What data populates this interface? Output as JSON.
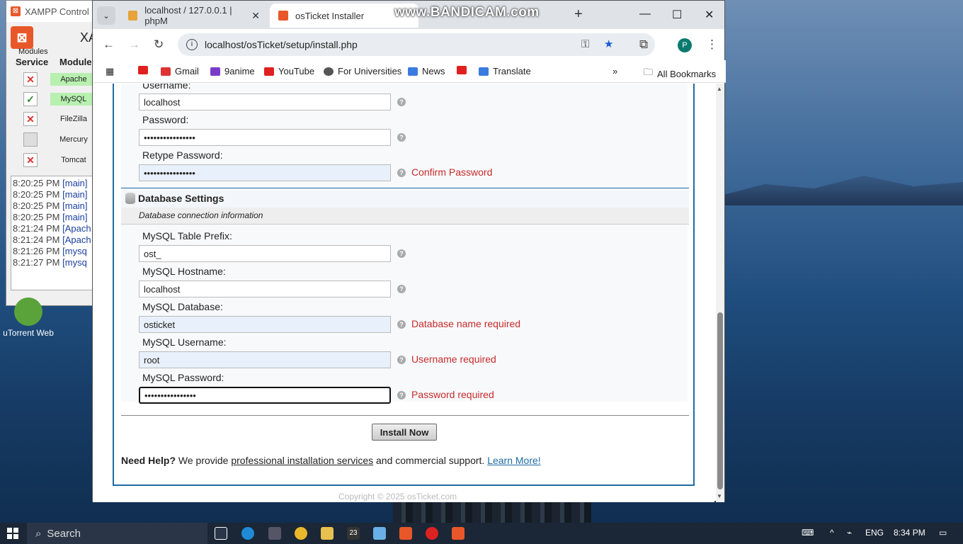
{
  "xampp": {
    "title": "XAMPP Control P",
    "header_partial": "XA",
    "modules_label": "Modules",
    "service_header": "Service",
    "module_header": "Module",
    "modules": [
      {
        "name": "Apache",
        "status": "x"
      },
      {
        "name": "MySQL",
        "status": "ok"
      },
      {
        "name": "FileZilla",
        "status": "x"
      },
      {
        "name": "Mercury",
        "status": "blank"
      },
      {
        "name": "Tomcat",
        "status": "x"
      }
    ],
    "log": [
      {
        "time": "8:20:25 PM",
        "tag": "[main]"
      },
      {
        "time": "8:20:25 PM",
        "tag": "[main]"
      },
      {
        "time": "8:20:25 PM",
        "tag": "[main]"
      },
      {
        "time": "8:20:25 PM",
        "tag": "[main]"
      },
      {
        "time": "8:21:24 PM",
        "tag": "[Apach"
      },
      {
        "time": "8:21:24 PM",
        "tag": "[Apach"
      },
      {
        "time": "8:21:26 PM",
        "tag": "[mysq"
      },
      {
        "time": "8:21:27 PM",
        "tag": "[mysq"
      }
    ]
  },
  "desktop": {
    "utorrent_label": "uTorrent Web"
  },
  "browser": {
    "tabs": [
      {
        "label": "localhost / 127.0.0.1 | phpM",
        "active": false
      },
      {
        "label": "osTicket Installer",
        "active": true
      }
    ],
    "watermark": "www.BANDICAM.com",
    "url": "localhost/osTicket/setup/install.php",
    "profile_initial": "P",
    "bookmarks": [
      "Gmail",
      "9anime",
      "YouTube",
      "For Universities",
      "News",
      "Translate"
    ],
    "all_bookmarks": "All Bookmarks"
  },
  "form": {
    "admin": {
      "username_label": "Username:",
      "username_value": "localhost",
      "password_label": "Password:",
      "password_value": "••••••••••••••••",
      "retype_label": "Retype Password:",
      "retype_value": "••••••••••••••••",
      "retype_error": "Confirm Password"
    },
    "db_section_title": "Database Settings",
    "db_section_subtitle": "Database connection information",
    "prefix_label": "MySQL Table Prefix:",
    "prefix_value": "ost_",
    "host_label": "MySQL Hostname:",
    "host_value": "localhost",
    "db_label": "MySQL Database:",
    "db_value": "osticket",
    "db_error": "Database name required",
    "user_label": "MySQL Username:",
    "user_value": "root",
    "user_error": "Username required",
    "pass_label": "MySQL Password:",
    "pass_value": "••••••••••••••••",
    "pass_error": "Password required",
    "help_glyph": "?",
    "install_button": "Install Now",
    "help_bold": "Need Help?",
    "help_text1": " We provide ",
    "help_link1": "professional installation services",
    "help_text2": " and commercial support. ",
    "help_link2": "Learn More!",
    "copyright": "Copyright © 2025 osTicket.com"
  },
  "taskbar": {
    "search": "Search",
    "lang": "ENG",
    "time": "8:34 PM",
    "badge": "23"
  }
}
